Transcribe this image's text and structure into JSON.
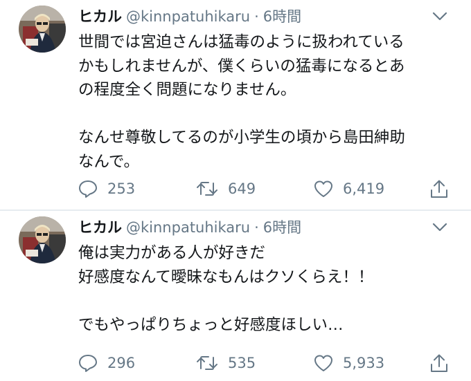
{
  "colors": {
    "text": "#14171a",
    "secondary": "#657786",
    "divider": "#e6ecf0"
  },
  "tweets": [
    {
      "display_name": "ヒカル",
      "handle": "@kinnpatuhikaru",
      "separator": "·",
      "time": "6時間",
      "lines": [
        "世間では宮迫さんは猛毒のように扱われている",
        "かもしれませんが、僕くらいの猛毒になるとあ",
        "の程度全く問題になりません。",
        "",
        "なんせ尊敬してるのが小学生の頃から島田紳助",
        "なんで。"
      ],
      "replies": "253",
      "retweets": "649",
      "likes": "6,419",
      "icons": [
        "reply-icon",
        "retweet-icon",
        "like-icon",
        "share-icon"
      ]
    },
    {
      "display_name": "ヒカル",
      "handle": "@kinnpatuhikaru",
      "separator": "·",
      "time": "6時間",
      "lines": [
        "俺は実力がある人が好きだ",
        "好感度なんて曖昧なもんはクソくらえ！！",
        "",
        "でもやっぱりちょっと好感度ほしい…"
      ],
      "replies": "296",
      "retweets": "535",
      "likes": "5,933",
      "icons": [
        "reply-icon",
        "retweet-icon",
        "like-icon",
        "share-icon"
      ]
    }
  ]
}
